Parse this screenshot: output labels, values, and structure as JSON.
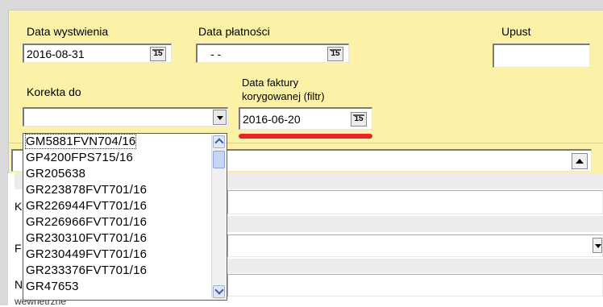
{
  "form": {
    "issue_date_label": "Data wystwienia",
    "issue_date_value": "2016-08-31",
    "payment_date_label": "Data płatności",
    "payment_date_value": "- -",
    "discount_label": "Upust",
    "discount_value": "",
    "correction_label": "Korekta do",
    "correction_value": "",
    "corrected_invoice_date_label_line1": "Data faktury",
    "corrected_invoice_date_label_line2": "korygowanej (filtr)",
    "corrected_invoice_date_value": "2016-06-20",
    "calendar_button_label": "15"
  },
  "dropdown_options": [
    "GM5881FVN704/16",
    "GP4200FPS715/16",
    "GR205638",
    "GR223878FVT701/16",
    "GR226944FVT701/16",
    "GR226966FVT701/16",
    "GR230310FVT701/16",
    "GR230449FVT701/16",
    "GR233376FVT701/16",
    "GR47653"
  ],
  "background_labels": {
    "k_label": "K",
    "f_label": "F",
    "n_label": "N",
    "truncated_label": "wewnetrzne"
  },
  "colors": {
    "panel": "#fbf2a8",
    "highlight_underline": "#e8242a"
  }
}
